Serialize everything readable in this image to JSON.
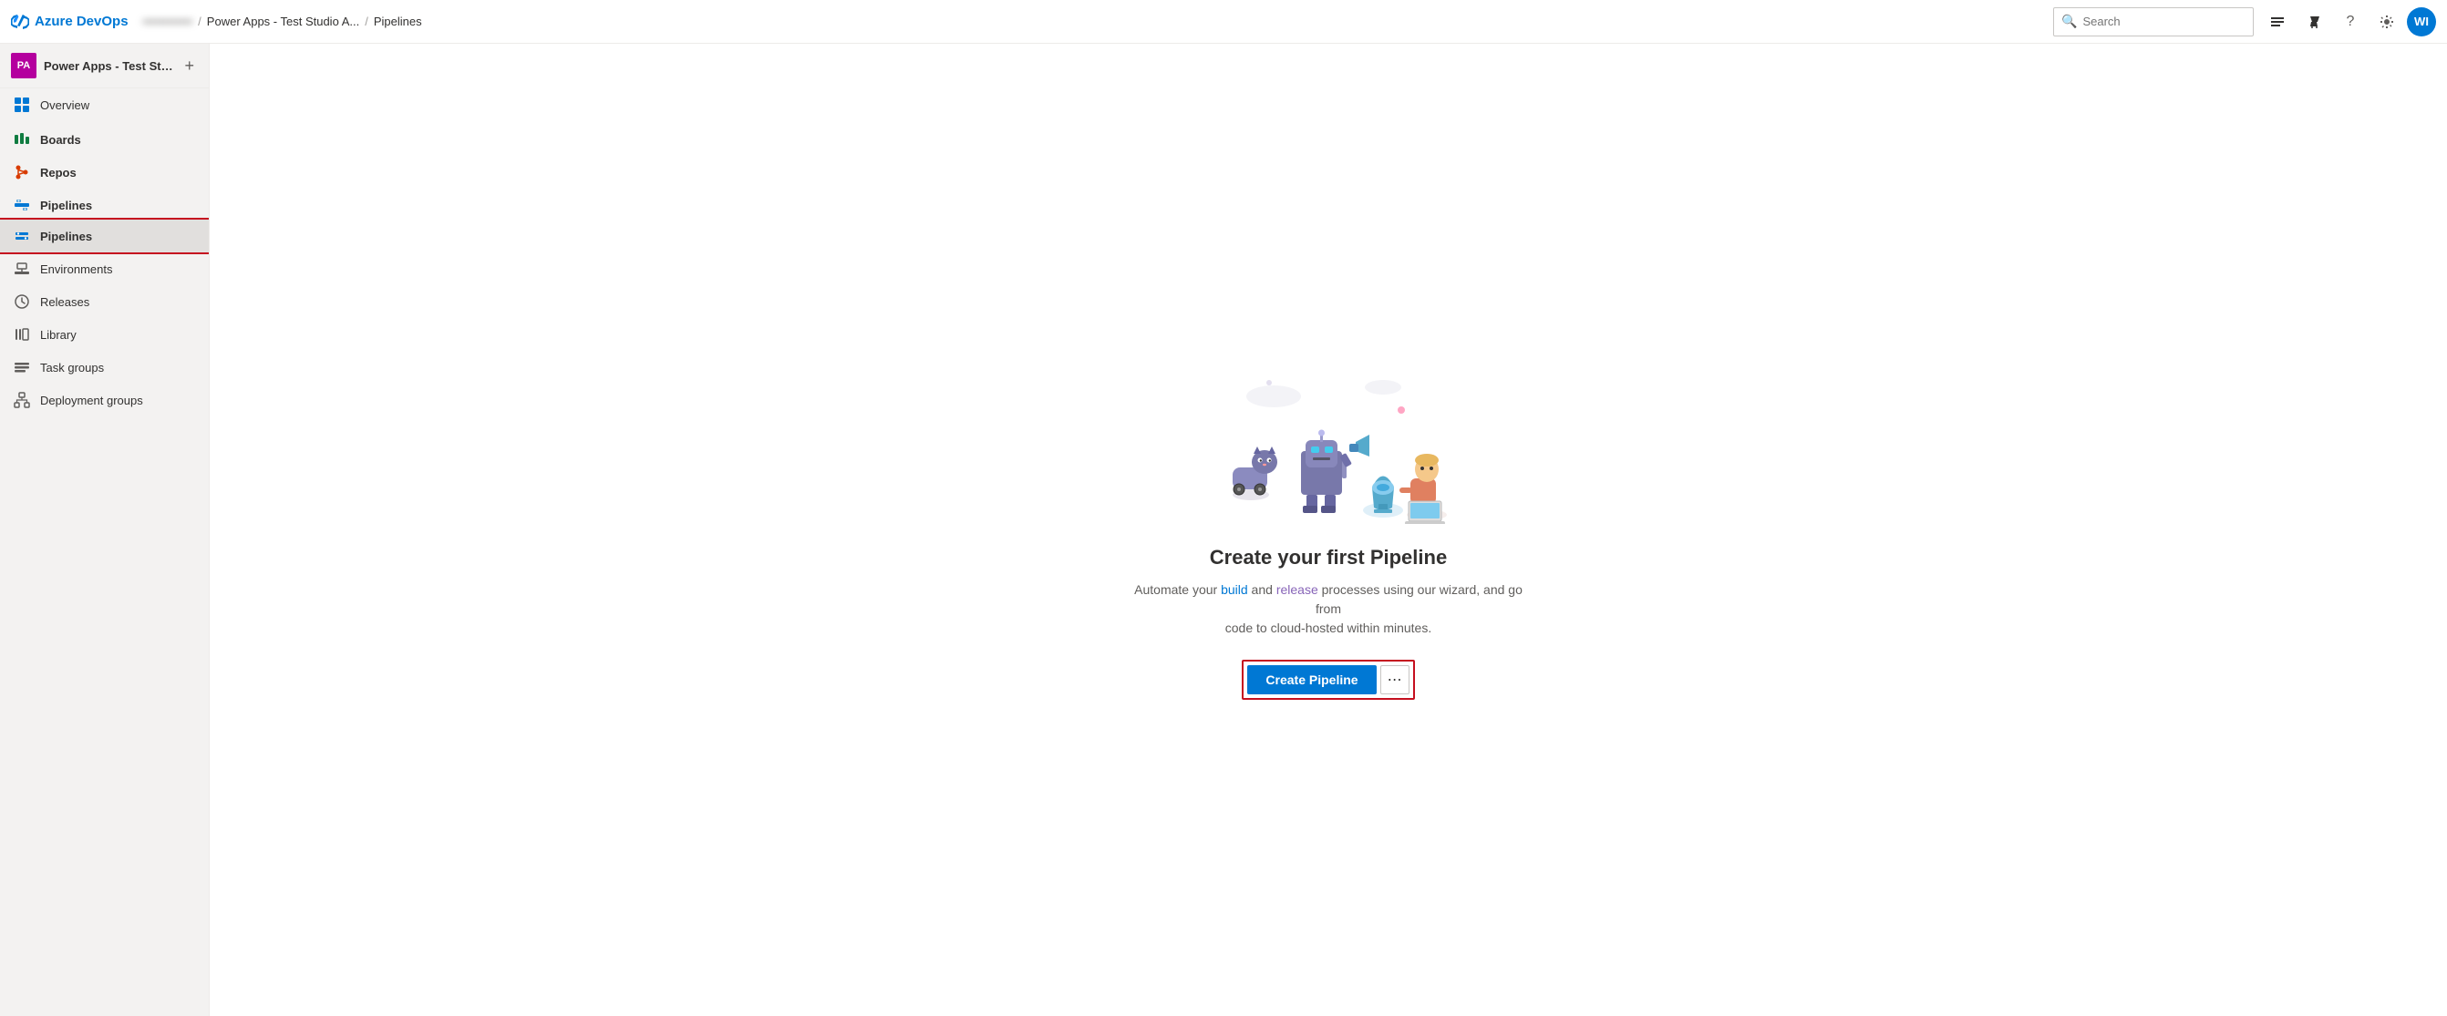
{
  "header": {
    "logo_text": "Azure DevOps",
    "breadcrumb": [
      {
        "label": "••••••••••••",
        "blurred": true
      },
      {
        "label": "/"
      },
      {
        "label": "Power Apps - Test Studio A..."
      },
      {
        "label": "/"
      },
      {
        "label": "Pipelines"
      }
    ],
    "search_placeholder": "Search",
    "avatar_initials": "WI"
  },
  "sidebar": {
    "project_initials": "PA",
    "project_name": "Power Apps - Test Stud...",
    "nav_items": [
      {
        "id": "overview",
        "label": "Overview",
        "icon": "overview"
      },
      {
        "id": "boards",
        "label": "Boards",
        "icon": "boards",
        "is_section": true
      },
      {
        "id": "repos",
        "label": "Repos",
        "icon": "repos",
        "is_section": true
      },
      {
        "id": "pipelines-section",
        "label": "Pipelines",
        "icon": "pipelines-section",
        "is_section": true
      },
      {
        "id": "pipelines-item",
        "label": "Pipelines",
        "icon": "pipelines-item",
        "is_active": true,
        "is_selected": true
      },
      {
        "id": "environments",
        "label": "Environments",
        "icon": "environments"
      },
      {
        "id": "releases",
        "label": "Releases",
        "icon": "releases"
      },
      {
        "id": "library",
        "label": "Library",
        "icon": "library"
      },
      {
        "id": "task-groups",
        "label": "Task groups",
        "icon": "taskgroups"
      },
      {
        "id": "deployment-groups",
        "label": "Deployment groups",
        "icon": "deploymentgroups"
      }
    ]
  },
  "main": {
    "title": "Create your first Pipeline",
    "description_part1": "Automate your build and ",
    "description_link1": "build",
    "description_part2": " and release processes using our wizard, and go from\ncode to cloud-hosted within minutes.",
    "description_link2": "release",
    "create_button_label": "Create Pipeline"
  }
}
